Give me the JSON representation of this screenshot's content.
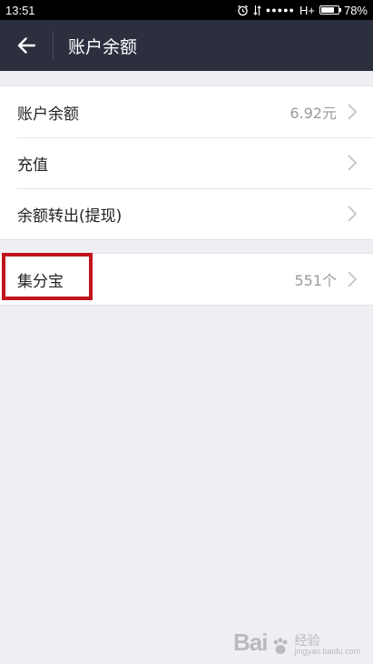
{
  "status_bar": {
    "time": "13:51",
    "signal_dots": "●●●●●",
    "network": "H+",
    "battery_percent": "78%",
    "battery_level": 0.78
  },
  "nav": {
    "title": "账户余额",
    "back_icon": "arrow-left-icon"
  },
  "groups": [
    {
      "items": [
        {
          "label": "账户余额",
          "value": "6.92元"
        },
        {
          "label": "充值",
          "value": ""
        },
        {
          "label": "余额转出(提现)",
          "value": ""
        }
      ]
    },
    {
      "items": [
        {
          "label": "集分宝",
          "value": "551个"
        }
      ]
    }
  ],
  "colors": {
    "nav_background": "#2c2f3e",
    "page_background": "#eeeef3",
    "highlight": "#c0141a"
  },
  "watermark": {
    "logo": "Bai",
    "text": "经验",
    "url": "jingyan.baidu.com"
  }
}
